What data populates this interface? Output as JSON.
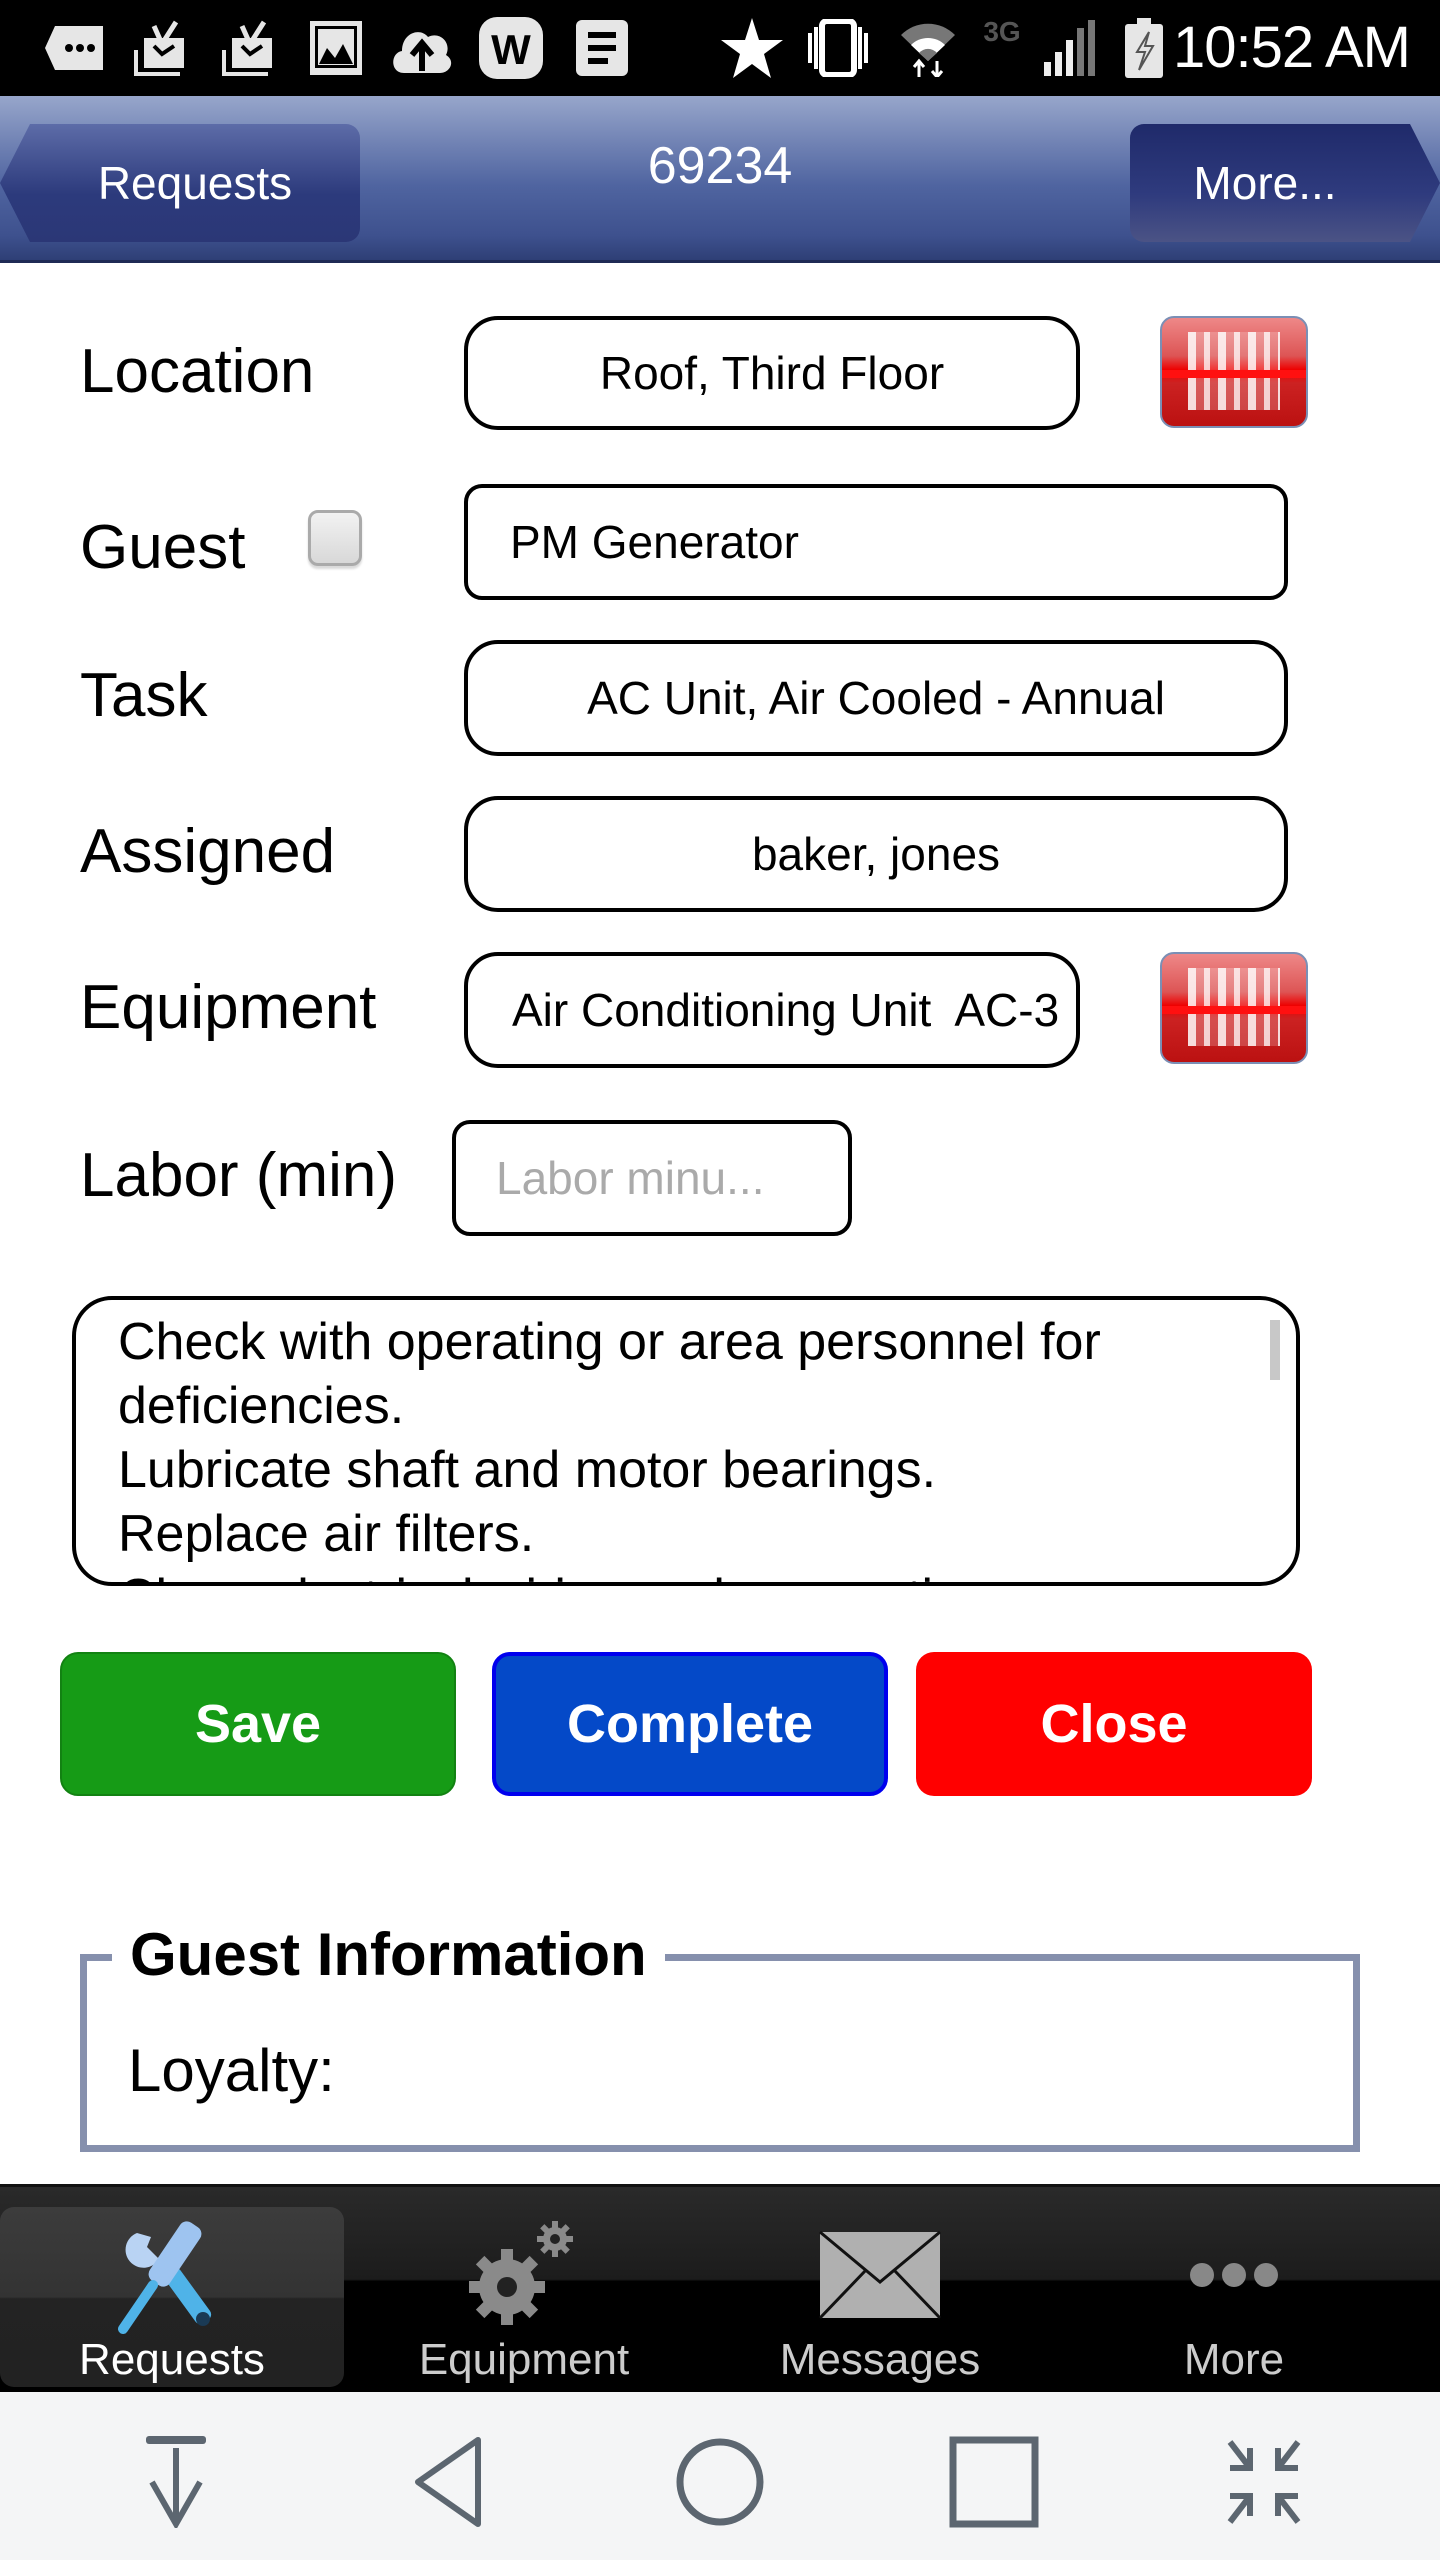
{
  "status_bar": {
    "time": "10:52 AM",
    "network": "3G",
    "left_icons": [
      "more-notifications-icon",
      "mail-check-icon",
      "mail-check-icon",
      "image-icon",
      "cloud-upload-icon",
      "w-app-icon",
      "notes-icon"
    ],
    "right_icons": [
      "star-icon",
      "vibrate-icon",
      "wifi-icon",
      "network-3g-icon",
      "signal-icon",
      "battery-charging-icon"
    ]
  },
  "nav": {
    "title": "69234",
    "back_label": "Requests",
    "more_label": "More..."
  },
  "form": {
    "location": {
      "label": "Location",
      "value": "Roof, Third Floor"
    },
    "guest": {
      "label": "Guest",
      "checked": false,
      "value": "PM Generator"
    },
    "task": {
      "label": "Task",
      "value": "AC Unit, Air Cooled - Annual"
    },
    "assigned": {
      "label": "Assigned",
      "value": "baker, jones"
    },
    "equipment": {
      "label": "Equipment",
      "value": "Air Conditioning Unit  AC-3"
    },
    "labor": {
      "label": "Labor (min)",
      "value": "",
      "placeholder": "Labor minu..."
    },
    "notes": [
      "Check with operating or area personnel for deficiencies.",
      "Lubricate shaft and motor bearings.",
      "Replace air filters.",
      "Clean electrical wiring and connections;"
    ]
  },
  "actions": {
    "save": "Save",
    "complete": "Complete",
    "close": "Close"
  },
  "guest_info": {
    "title": "Guest Information",
    "loyalty_label": "Loyalty:",
    "loyalty_value": ""
  },
  "colors": {
    "save": "#169b16",
    "complete": "#0449c8",
    "close": "#ff0000",
    "nav_bar": "#4f64a0",
    "tab_active_icon": "#4fb3e8"
  },
  "tabs": [
    {
      "label": "Requests",
      "icon": "tools-icon",
      "active": true
    },
    {
      "label": "Equipment",
      "icon": "gears-icon",
      "active": false
    },
    {
      "label": "Messages",
      "icon": "envelope-icon",
      "active": false
    },
    {
      "label": "More",
      "icon": "more-dots-icon",
      "active": false
    }
  ],
  "system_nav": [
    "hide-keyboard",
    "back",
    "home",
    "recents",
    "collapse"
  ]
}
